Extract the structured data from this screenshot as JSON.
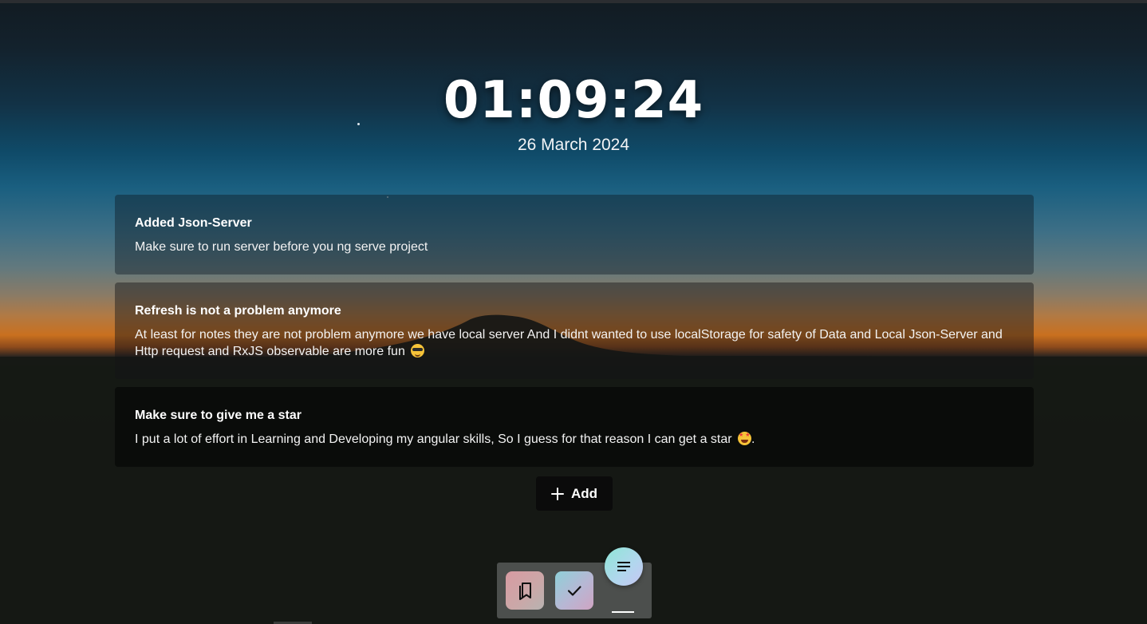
{
  "clock": {
    "time": "01:09:24",
    "date": "26 March 2024"
  },
  "notes": [
    {
      "title": "Added Json-Server",
      "body": "Make sure to run server before you ng serve project"
    },
    {
      "title": "Refresh is not a problem anymore",
      "body": "At least for notes they are not problem anymore we have local server And I didnt wanted to use localStorage for safety of Data and Local Json-Server and Http request and RxJS observable are more fun",
      "emoji": "smiling-face-with-sunglasses"
    },
    {
      "title": "Make sure to give me a star",
      "body": "I put a lot of effort in Learning and Developing my angular skills, So I guess for that reason I can get a star",
      "emoji": "star-struck",
      "suffix": "."
    }
  ],
  "add_button": {
    "label": "Add",
    "icon": "plus-icon"
  },
  "dock": {
    "items": [
      {
        "icon": "bookmarks-icon",
        "color_from": "#d89ba2",
        "color_to": "#b7b3b1"
      },
      {
        "icon": "check-icon",
        "color_from": "#8fd0d8",
        "color_to": "#cfa4c2"
      }
    ],
    "fab_icon": "menu-lines-icon"
  },
  "colors": {
    "accent_fab": "#8ee6d6",
    "button_bg": "#0b0b0b",
    "text": "#ffffff"
  }
}
